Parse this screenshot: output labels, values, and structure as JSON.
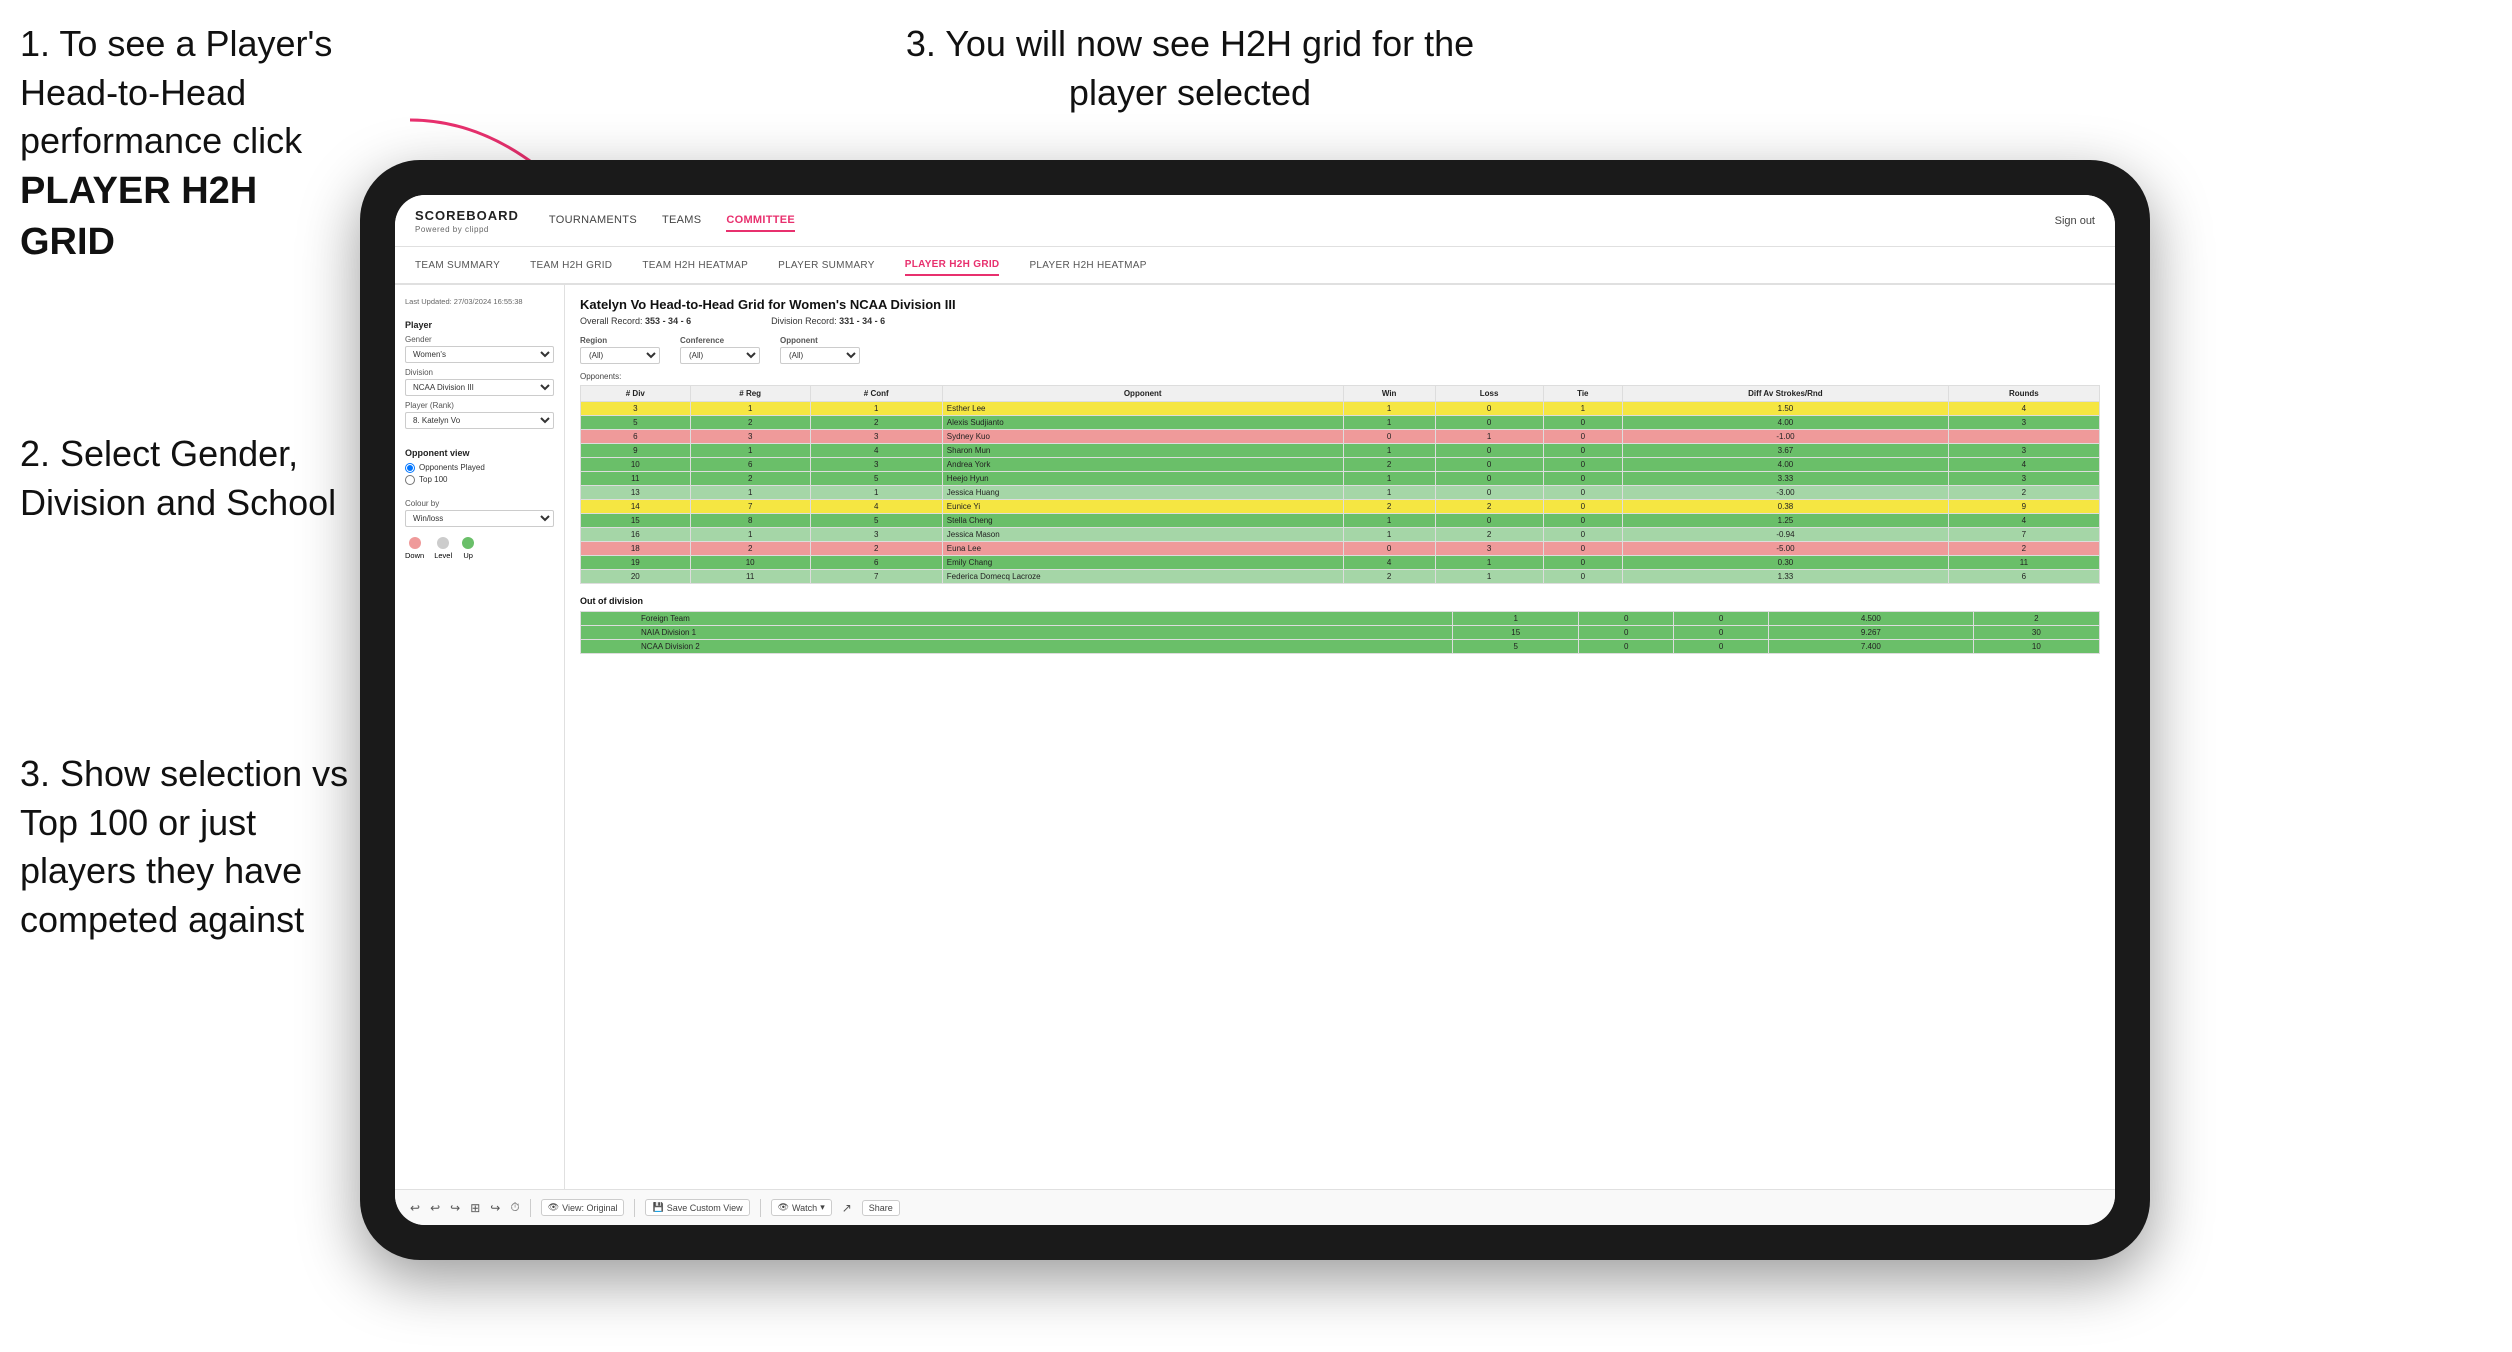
{
  "instructions": {
    "step1_title": "1. To see a Player's Head-to-Head performance click",
    "step1_bold": "PLAYER H2H GRID",
    "step2_title": "2. Select Gender, Division and School",
    "step3_left_title": "3. Show selection vs Top 100 or just players they have competed against",
    "step3_right_title": "3. You will now see H2H grid for the player selected"
  },
  "nav": {
    "logo": "SCOREBOARD",
    "logo_sub": "Powered by clippd",
    "items": [
      "TOURNAMENTS",
      "TEAMS",
      "COMMITTEE"
    ],
    "active_item": "COMMITTEE",
    "sign_out": "Sign out"
  },
  "sub_nav": {
    "items": [
      "TEAM SUMMARY",
      "TEAM H2H GRID",
      "TEAM H2H HEATMAP",
      "PLAYER SUMMARY",
      "PLAYER H2H GRID",
      "PLAYER H2H HEATMAP"
    ],
    "active": "PLAYER H2H GRID"
  },
  "sidebar": {
    "timestamp": "Last Updated: 27/03/2024\n16:55:38",
    "player_section": "Player",
    "gender_label": "Gender",
    "gender_value": "Women's",
    "division_label": "Division",
    "division_value": "NCAA Division III",
    "player_rank_label": "Player (Rank)",
    "player_rank_value": "8. Katelyn Vo",
    "opponent_view_label": "Opponent view",
    "opponent_options": [
      "Opponents Played",
      "Top 100"
    ],
    "opponent_selected": "Opponents Played",
    "colour_by_label": "Colour by",
    "colour_by_value": "Win/loss",
    "colour_legend": [
      {
        "label": "Down",
        "color": "#ef9a9a"
      },
      {
        "label": "Level",
        "color": "#cccccc"
      },
      {
        "label": "Up",
        "color": "#6abf69"
      }
    ]
  },
  "grid": {
    "title": "Katelyn Vo Head-to-Head Grid for Women's NCAA Division III",
    "overall_record_label": "Overall Record:",
    "overall_record_value": "353 - 34 - 6",
    "division_record_label": "Division Record:",
    "division_record_value": "331 - 34 - 6",
    "region_label": "Region",
    "conference_label": "Conference",
    "opponent_label": "Opponent",
    "opponents_label": "Opponents:",
    "region_filter": "(All)",
    "conference_filter": "(All)",
    "opponent_filter": "(All)",
    "columns": [
      "# Div",
      "# Reg",
      "# Conf",
      "Opponent",
      "Win",
      "Loss",
      "Tie",
      "Diff Av Strokes/Rnd",
      "Rounds"
    ],
    "rows": [
      {
        "div": "3",
        "reg": "1",
        "conf": "1",
        "opponent": "Esther Lee",
        "win": 1,
        "loss": 0,
        "tie": 1,
        "diff": "1.50",
        "rounds": 4,
        "color": "yellow"
      },
      {
        "div": "5",
        "reg": "2",
        "conf": "2",
        "opponent": "Alexis Sudjianto",
        "win": 1,
        "loss": 0,
        "tie": 0,
        "diff": "4.00",
        "rounds": 3,
        "color": "green"
      },
      {
        "div": "6",
        "reg": "3",
        "conf": "3",
        "opponent": "Sydney Kuo",
        "win": 0,
        "loss": 1,
        "tie": 0,
        "diff": "-1.00",
        "rounds": "",
        "color": "red"
      },
      {
        "div": "9",
        "reg": "1",
        "conf": "4",
        "opponent": "Sharon Mun",
        "win": 1,
        "loss": 0,
        "tie": 0,
        "diff": "3.67",
        "rounds": 3,
        "color": "green"
      },
      {
        "div": "10",
        "reg": "6",
        "conf": "3",
        "opponent": "Andrea York",
        "win": 2,
        "loss": 0,
        "tie": 0,
        "diff": "4.00",
        "rounds": 4,
        "color": "green"
      },
      {
        "div": "11",
        "reg": "2",
        "conf": "5",
        "opponent": "Heejo Hyun",
        "win": 1,
        "loss": 0,
        "tie": 0,
        "diff": "3.33",
        "rounds": 3,
        "color": "green"
      },
      {
        "div": "13",
        "reg": "1",
        "conf": "1",
        "opponent": "Jessica Huang",
        "win": 1,
        "loss": 0,
        "tie": 0,
        "diff": "-3.00",
        "rounds": 2,
        "color": "light-green"
      },
      {
        "div": "14",
        "reg": "7",
        "conf": "4",
        "opponent": "Eunice Yi",
        "win": 2,
        "loss": 2,
        "tie": 0,
        "diff": "0.38",
        "rounds": 9,
        "color": "yellow"
      },
      {
        "div": "15",
        "reg": "8",
        "conf": "5",
        "opponent": "Stella Cheng",
        "win": 1,
        "loss": 0,
        "tie": 0,
        "diff": "1.25",
        "rounds": 4,
        "color": "green"
      },
      {
        "div": "16",
        "reg": "1",
        "conf": "3",
        "opponent": "Jessica Mason",
        "win": 1,
        "loss": 2,
        "tie": 0,
        "diff": "-0.94",
        "rounds": 7,
        "color": "light-green"
      },
      {
        "div": "18",
        "reg": "2",
        "conf": "2",
        "opponent": "Euna Lee",
        "win": 0,
        "loss": 3,
        "tie": 0,
        "diff": "-5.00",
        "rounds": 2,
        "color": "red"
      },
      {
        "div": "19",
        "reg": "10",
        "conf": "6",
        "opponent": "Emily Chang",
        "win": 4,
        "loss": 1,
        "tie": 0,
        "diff": "0.30",
        "rounds": 11,
        "color": "green"
      },
      {
        "div": "20",
        "reg": "11",
        "conf": "7",
        "opponent": "Federica Domecq Lacroze",
        "win": 2,
        "loss": 1,
        "tie": 0,
        "diff": "1.33",
        "rounds": 6,
        "color": "light-green"
      }
    ],
    "out_of_division_title": "Out of division",
    "out_of_division_rows": [
      {
        "opponent": "Foreign Team",
        "win": 1,
        "loss": 0,
        "tie": 0,
        "diff": "4.500",
        "rounds": 2,
        "color": "green"
      },
      {
        "opponent": "NAIA Division 1",
        "win": 15,
        "loss": 0,
        "tie": 0,
        "diff": "9.267",
        "rounds": 30,
        "color": "green"
      },
      {
        "opponent": "NCAA Division 2",
        "win": 5,
        "loss": 0,
        "tie": 0,
        "diff": "7.400",
        "rounds": 10,
        "color": "green"
      }
    ]
  },
  "toolbar": {
    "view_original": "View: Original",
    "save_custom": "Save Custom View",
    "watch": "Watch",
    "share": "Share"
  }
}
